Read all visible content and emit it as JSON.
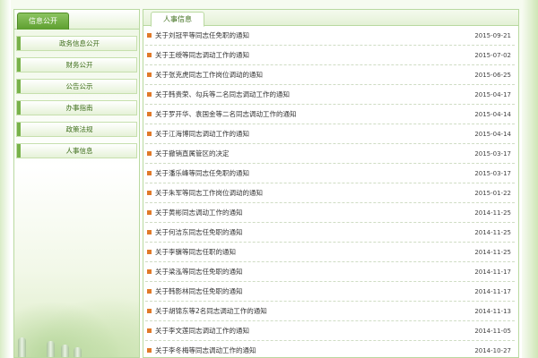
{
  "sidebar": {
    "header_title": "信息公开",
    "items": [
      {
        "label": "政务信息公开"
      },
      {
        "label": "财务公开"
      },
      {
        "label": "公告公示"
      },
      {
        "label": "办事指南"
      },
      {
        "label": "政策法规"
      },
      {
        "label": "人事信息"
      }
    ]
  },
  "main": {
    "tab_title": "人事信息",
    "news": [
      {
        "title": "关于刘冠平等同志任免职的通知",
        "date": "2015-09-21"
      },
      {
        "title": "关于王绶等同志调动工作的通知",
        "date": "2015-07-02"
      },
      {
        "title": "关于张克虎同志工作岗位调动的通知",
        "date": "2015-06-25"
      },
      {
        "title": "关于韩贵荣、勾兵等二名同志调动工作的通知",
        "date": "2015-04-17"
      },
      {
        "title": "关于罗开华、袁国金等二名同志调动工作的通知",
        "date": "2015-04-14"
      },
      {
        "title": "关于江海博同志调动工作的通知",
        "date": "2015-04-14"
      },
      {
        "title": "关于撤销直属管区的决定",
        "date": "2015-03-17"
      },
      {
        "title": "关于潘乐峰等同志任免职的通知",
        "date": "2015-03-17"
      },
      {
        "title": "关于朱军等同志工作岗位调动的通知",
        "date": "2015-01-22"
      },
      {
        "title": "关于黄彬同志调动工作的通知",
        "date": "2014-11-25"
      },
      {
        "title": "关于何洁东同志任免职的通知",
        "date": "2014-11-25"
      },
      {
        "title": "关于李骥等同志任职的通知",
        "date": "2014-11-25"
      },
      {
        "title": "关于梁泓等同志任免职的通知",
        "date": "2014-11-17"
      },
      {
        "title": "关于韩影林同志任免职的通知",
        "date": "2014-11-17"
      },
      {
        "title": "关于胡锦东等2名同志调动工作的通知",
        "date": "2014-11-13"
      },
      {
        "title": "关于李文莲同志调动工作的通知",
        "date": "2014-11-05"
      },
      {
        "title": "关于李冬梅等同志调动工作的通知",
        "date": "2014-10-27"
      }
    ]
  }
}
